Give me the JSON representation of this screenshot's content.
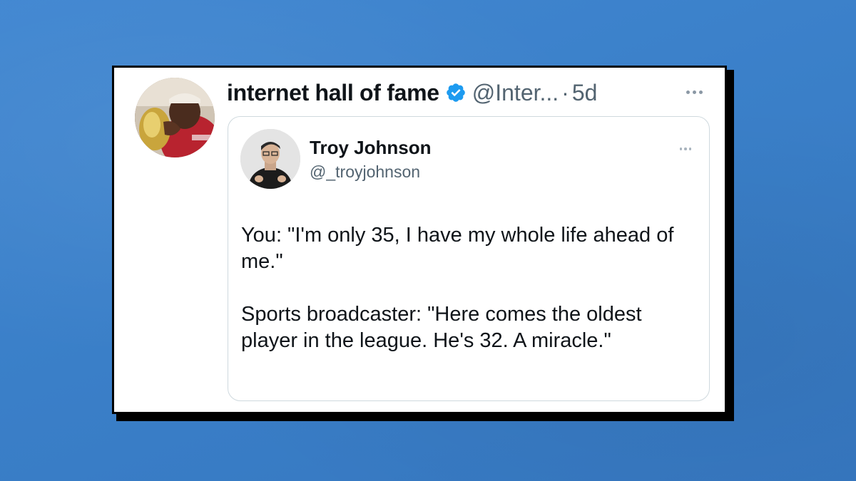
{
  "tweet": {
    "display_name": "internet hall of fame",
    "handle": "@Inter...",
    "separator": "·",
    "timestamp": "5d",
    "verified_icon": "verified-badge-icon",
    "more_icon": "more-horizontal-icon"
  },
  "quoted": {
    "display_name": "Troy Johnson",
    "handle": "@_troyjohnson",
    "more_icon": "more-horizontal-icon",
    "body": [
      "You: \"I'm only 35, I have my whole life ahead of me.\"",
      "Sports broadcaster: \"Here comes the oldest player in the league. He's 32. A miracle.\""
    ]
  },
  "colors": {
    "background": "#3a80c9",
    "verified": "#1d9bf0",
    "secondary_text": "#536471",
    "primary_text": "#0f1419",
    "border": "#cfd9de"
  }
}
